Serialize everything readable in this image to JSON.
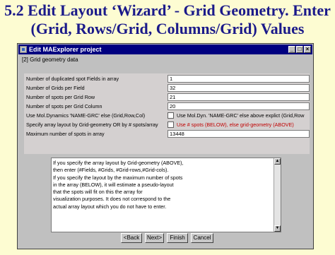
{
  "slide": {
    "title_line1": "5.2 Edit Layout ‘Wizard’ - Grid Geometry. Enter",
    "title_line2": "(Grid, Rows/Grid, Columns/Grid) Values"
  },
  "window": {
    "title": "Edit MAExplorer project",
    "controls": {
      "minimize": "_",
      "maximize": "□",
      "close": "×"
    }
  },
  "section": {
    "label": "[2] Grid geometry data"
  },
  "fields": [
    {
      "label": "Number of duplicated spot Fields in array",
      "value": "1"
    },
    {
      "label": "Number of Grids per Field",
      "value": "32"
    },
    {
      "label": "Number of spots per Grid Row",
      "value": "21"
    },
    {
      "label": "Number of spots per Grid Column",
      "value": "20"
    }
  ],
  "checkboxes": [
    {
      "label": "Use Mol.Dynamics 'NAME-GRC' else (Grid,Row,Col)",
      "option_text": "Use Mol.Dyn. 'NAME-GRC' else above explict (Grid,Row",
      "checked": false,
      "color": "#000000"
    },
    {
      "label": "Specify array layout by Grid-geometry OR by # spots/array",
      "option_text": "Use # spots (BELOW), else grid-geometry (ABOVE)",
      "checked": false,
      "color": "#c00000"
    }
  ],
  "max_spots": {
    "label": "Maximum number of spots in array",
    "value": "13448"
  },
  "help_text": [
    "If you specify the array layout by Grid-geometry (ABOVE),",
    "then enter (#Fields, #Grids, #Grid-rows,#Grid-cols).",
    "If you specify the layout by the maximum number of spots",
    "in the array (BELOW), it will estimate a pseudo-layout",
    "that the spots will fit on this the array for",
    "visualization purposes. It does not correspond to the",
    "actual array layout which you do not have to enter."
  ],
  "buttons": {
    "back": "<Back",
    "next": "Next>",
    "finish": "Finish",
    "cancel": "Cancel"
  },
  "colors": {
    "slide_background": "#fdfcd2",
    "slide_title": "#1b1a8a",
    "titlebar": "#000080",
    "window_face": "#c0c0c0"
  }
}
